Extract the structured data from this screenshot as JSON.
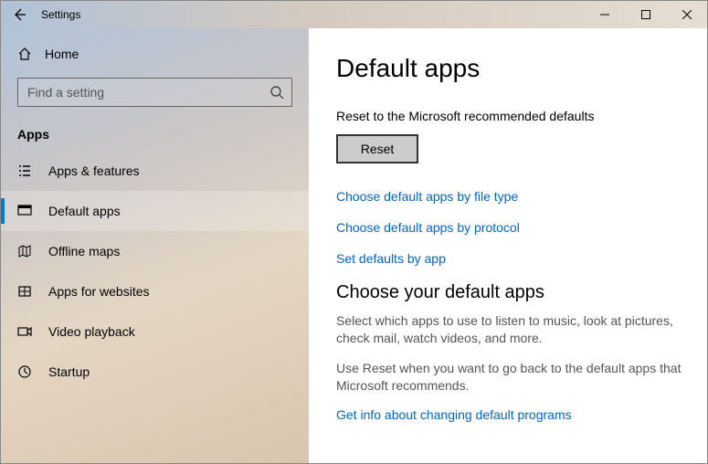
{
  "window": {
    "title": "Settings"
  },
  "sidebar": {
    "home_label": "Home",
    "search_placeholder": "Find a setting",
    "category": "Apps",
    "items": [
      {
        "label": "Apps & features"
      },
      {
        "label": "Default apps"
      },
      {
        "label": "Offline maps"
      },
      {
        "label": "Apps for websites"
      },
      {
        "label": "Video playback"
      },
      {
        "label": "Startup"
      }
    ]
  },
  "main": {
    "heading": "Default apps",
    "reset_text": "Reset to the Microsoft recommended defaults",
    "reset_button": "Reset",
    "links": [
      "Choose default apps by file type",
      "Choose default apps by protocol",
      "Set defaults by app"
    ],
    "section_heading": "Choose your default apps",
    "desc1": "Select which apps to use to listen to music, look at pictures, check mail, watch videos, and more.",
    "desc2": "Use Reset when you want to go back to the default apps that Microsoft recommends.",
    "info_link": "Get info about changing default programs"
  }
}
